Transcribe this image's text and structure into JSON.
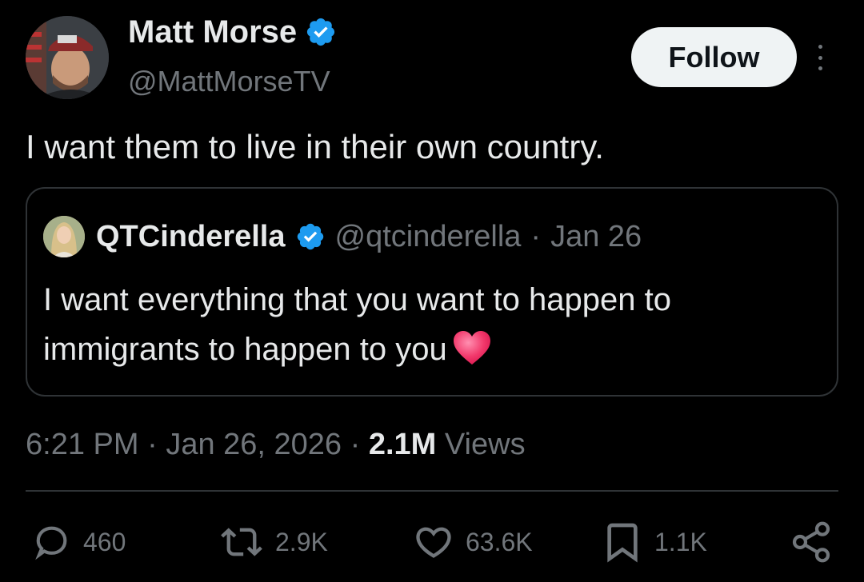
{
  "author": {
    "name": "Matt Morse",
    "handle": "@MattMorseTV"
  },
  "follow_label": "Follow",
  "tweet_text": "I want them to live in their own country.",
  "quote": {
    "name": "QTCinderella",
    "handle": "@qtcinderella",
    "separator": "·",
    "date": "Jan 26",
    "text": "I want everything that you want to happen to immigrants to happen to you"
  },
  "meta": {
    "time": "6:21 PM",
    "sep1": "·",
    "date": "Jan 26, 2026",
    "sep2": "·",
    "views_count": "2.1M",
    "views_label": "Views"
  },
  "actions": {
    "replies": "460",
    "reposts": "2.9K",
    "likes": "63.6K",
    "bookmarks": "1.1K"
  },
  "colors": {
    "background": "#000000",
    "text": "#e7e9ea",
    "muted": "#71767b",
    "verified": "#1d9bf0",
    "border": "#2f3336",
    "follow_bg": "#eff3f4"
  }
}
